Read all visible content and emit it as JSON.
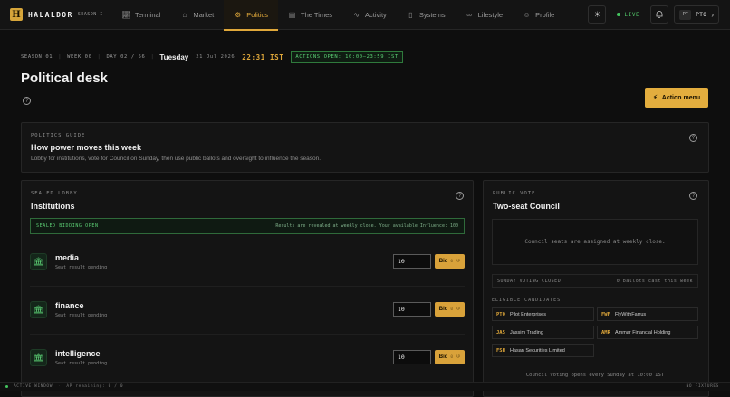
{
  "brand": {
    "logo_letter": "H",
    "name": "HALALDOR",
    "season": "SEASON I"
  },
  "nav": {
    "tabs": [
      {
        "label": "Terminal",
        "icon": "chart-icon"
      },
      {
        "label": "Market",
        "icon": "bank-icon"
      },
      {
        "label": "Politics",
        "icon": "gear-icon",
        "active": true
      },
      {
        "label": "The Times",
        "icon": "newspaper-icon"
      },
      {
        "label": "Activity",
        "icon": "pulse-icon"
      },
      {
        "label": "Systems",
        "icon": "document-icon"
      },
      {
        "label": "Lifestyle",
        "icon": "link-icon"
      },
      {
        "label": "Profile",
        "icon": "user-icon"
      }
    ],
    "live_label": "LIVE",
    "user_avatar": "PT",
    "user_code": "PTO"
  },
  "status": {
    "season": "SEASON 01",
    "week": "WEEK 00",
    "day": "DAY 02 / 56",
    "day_name": "Tuesday",
    "date": "21 Jul 2026",
    "time": "22:31 IST",
    "actions": "ACTIONS OPEN: 10:00–23:59 IST"
  },
  "page": {
    "title": "Political desk",
    "action_menu": "Action menu"
  },
  "guide": {
    "eyebrow": "POLITICS GUIDE",
    "title": "How power moves this week",
    "desc": "Lobby for institutions, vote for Council on Sunday, then use public ballots and oversight to influence the season."
  },
  "lobby": {
    "eyebrow": "SEALED LOBBY",
    "title": "Institutions",
    "banner_left": "SEALED BIDDING OPEN",
    "banner_right": "Results are revealed at weekly close. Your available Influence: 100",
    "institutions": [
      {
        "name": "media",
        "status": "Seat result pending",
        "bid": "10",
        "bid_label": "Bid",
        "cost": "0 AP"
      },
      {
        "name": "finance",
        "status": "Seat result pending",
        "bid": "10",
        "bid_label": "Bid",
        "cost": "0 AP"
      },
      {
        "name": "intelligence",
        "status": "Seat result pending",
        "bid": "10",
        "bid_label": "Bid",
        "cost": "0 AP"
      }
    ]
  },
  "vote": {
    "eyebrow": "PUBLIC VOTE",
    "title": "Two-seat Council",
    "council_msg": "Council seats are assigned at weekly close.",
    "voting_status": "SUNDAY VOTING CLOSED",
    "ballots": "0 ballots cast this week",
    "candidates_label": "ELIGIBLE CANDIDATES",
    "candidates": [
      {
        "code": "PTO",
        "name": "Pilot Enterprises"
      },
      {
        "code": "FWF",
        "name": "FlyWithFarrus"
      },
      {
        "code": "JAS",
        "name": "Jassim Trading"
      },
      {
        "code": "AMR",
        "name": "Ammar Financial Holding"
      },
      {
        "code": "FSH",
        "name": "Hasan Securities Limited"
      }
    ],
    "note": "Council voting opens every Sunday at 10:00 IST"
  },
  "footer": {
    "window": "ACTIVE WINDOW",
    "ap": "AP remaining: 0 / 0",
    "fixtures": "NO FIXTURES"
  },
  "colors": {
    "accent": "#e0a83a",
    "live": "#43c45e",
    "background": "#0e0e0e"
  }
}
